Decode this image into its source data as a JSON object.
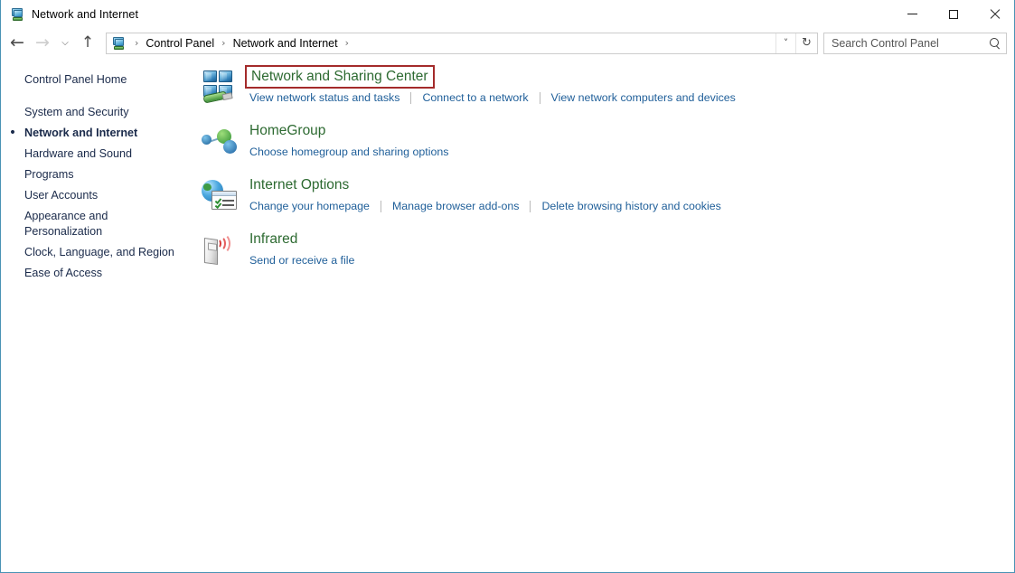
{
  "window": {
    "title": "Network and Internet",
    "icon": "network-computer-icon",
    "controls": {
      "minimize": "minimize-button",
      "maximize": "maximize-button",
      "close": "close-button"
    }
  },
  "navbar": {
    "back": "back-arrow",
    "forward": "forward-arrow",
    "recent": "recent-locations-chevron",
    "up": "up-arrow",
    "breadcrumb": {
      "icon": "control-panel-icon",
      "items": [
        "Control Panel",
        "Network and Internet"
      ],
      "separator": "›",
      "trailing_separator": "›"
    },
    "dropdown": "˅",
    "refresh": "↻"
  },
  "search": {
    "placeholder": "Search Control Panel",
    "value": "",
    "icon": "search-icon"
  },
  "sidebar": {
    "items": [
      {
        "label": "Control Panel Home",
        "current": false,
        "gap": false
      },
      {
        "label": "System and Security",
        "current": false,
        "gap": true
      },
      {
        "label": "Network and Internet",
        "current": true,
        "gap": false
      },
      {
        "label": "Hardware and Sound",
        "current": false,
        "gap": false
      },
      {
        "label": "Programs",
        "current": false,
        "gap": false
      },
      {
        "label": "User Accounts",
        "current": false,
        "gap": false
      },
      {
        "label": "Appearance and Personalization",
        "current": false,
        "gap": false
      },
      {
        "label": "Clock, Language, and Region",
        "current": false,
        "gap": false
      },
      {
        "label": "Ease of Access",
        "current": false,
        "gap": false
      }
    ],
    "bullet": "•"
  },
  "main": {
    "categories": [
      {
        "icon": "network-and-sharing-center-icon",
        "title": "Network and Sharing Center",
        "highlighted": true,
        "links": [
          "View network status and tasks",
          "Connect to a network",
          "View network computers and devices"
        ]
      },
      {
        "icon": "homegroup-icon",
        "title": "HomeGroup",
        "highlighted": false,
        "links": [
          "Choose homegroup and sharing options"
        ]
      },
      {
        "icon": "internet-options-icon",
        "title": "Internet Options",
        "highlighted": false,
        "links": [
          "Change your homepage",
          "Manage browser add-ons",
          "Delete browsing history and cookies"
        ]
      },
      {
        "icon": "infrared-icon",
        "title": "Infrared",
        "highlighted": false,
        "links": [
          "Send or receive a file"
        ]
      }
    ]
  },
  "colors": {
    "category_title": "#2d6a31",
    "link": "#21609a",
    "sidebar_text": "#1a2a4a",
    "highlight_border": "#a42b2b",
    "window_border": "#4a93b5"
  }
}
